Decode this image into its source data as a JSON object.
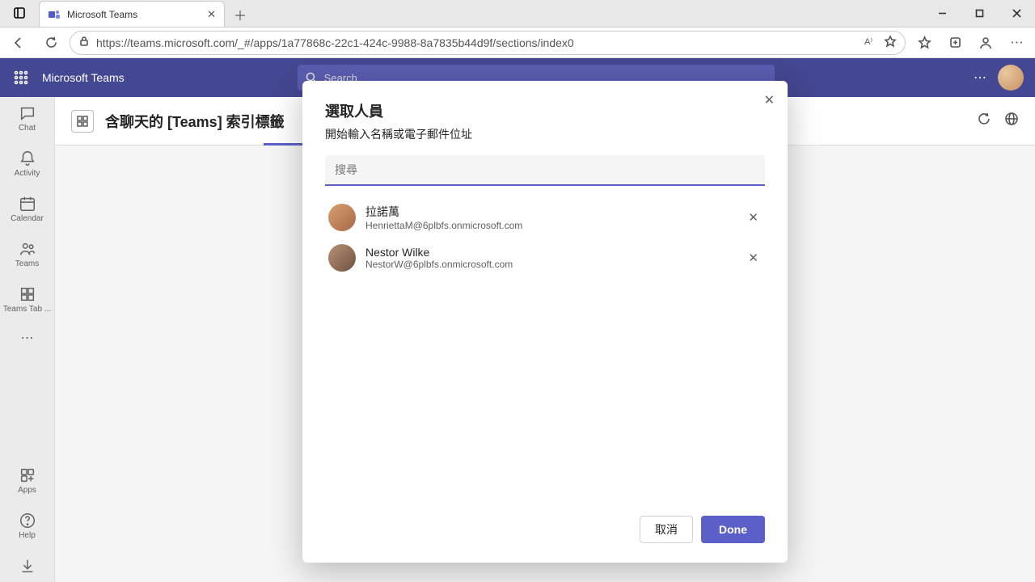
{
  "browser": {
    "tab_title": "Microsoft Teams",
    "url": "https://teams.microsoft.com/_#/apps/1a77868c-22c1-424c-9988-8a7835b44d9f/sections/index0"
  },
  "teams": {
    "app_title": "Microsoft Teams",
    "search_placeholder": "Search",
    "rail": {
      "chat": "Chat",
      "activity": "Activity",
      "calendar": "Calendar",
      "teams": "Teams",
      "teams_tab": "Teams Tab ...",
      "apps": "Apps",
      "help": "Help"
    },
    "page_title": "含聊天的 [Teams] 索引標籤"
  },
  "modal": {
    "title": "選取人員",
    "subtitle": "開始輸入名稱或電子郵件位址",
    "search_placeholder": "搜尋",
    "people": [
      {
        "name": "拉諾萬",
        "email": "HenriettaM@6plbfs.onmicrosoft.com"
      },
      {
        "name": "Nestor Wilke",
        "email": "NestorW@6plbfs.onmicrosoft.com"
      }
    ],
    "cancel": "取消",
    "done": "Done"
  }
}
